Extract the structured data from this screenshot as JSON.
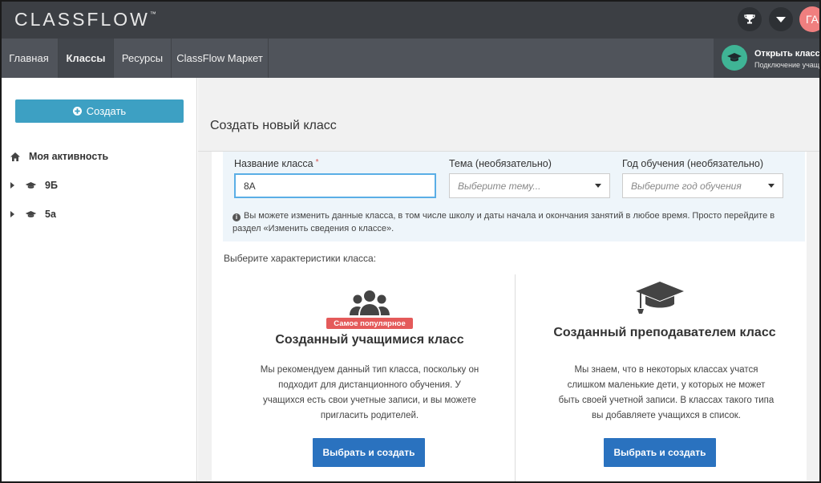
{
  "app": {
    "logo": "CLASSFLOW",
    "logo_tm": "™",
    "avatar_initials": "ГА"
  },
  "nav": {
    "tabs": [
      {
        "label": "Главная",
        "active": false
      },
      {
        "label": "Классы",
        "active": true
      },
      {
        "label": "Ресурсы",
        "active": false
      },
      {
        "label": "ClassFlow Маркет",
        "active": false
      }
    ],
    "open_class": {
      "title": "Открыть класс",
      "subtitle": "Подключение учащ..."
    }
  },
  "sidebar": {
    "create_label": "Создать",
    "items": [
      {
        "label": "Моя активность",
        "icon": "home-icon"
      },
      {
        "label": "9Б",
        "icon": "graduation-cap-icon"
      },
      {
        "label": "5а",
        "icon": "graduation-cap-icon"
      }
    ]
  },
  "main": {
    "title": "Создать новый класс",
    "form": {
      "class_name_label": "Название класса",
      "required_mark": "*",
      "class_name_value": "8А",
      "subject_label": "Тема (необязательно)",
      "subject_placeholder": "Выберите тему...",
      "year_label": "Год обучения (необязательно)",
      "year_placeholder": "Выберите год обучения",
      "info_text": "Вы можете изменить данные класса, в том числе школу и даты начала и окончания занятий в любое время. Просто перейдите в раздел «Изменить сведения о классе»."
    },
    "choose_label": "Выберите характеристики класса:",
    "cards": [
      {
        "badge": "Самое популярное",
        "title": "Созданный учащимися класс",
        "desc": "Мы рекомендуем данный тип класса, поскольку он подходит для дистанционного обучения. У учащихся есть свои учетные записи, и вы можете пригласить родителей.",
        "button": "Выбрать и создать"
      },
      {
        "title": "Созданный преподавателем класс",
        "desc": "Мы знаем, что в некоторых классах учатся слишком маленькие дети, у которых не может быть своей учетной записи. В классах такого типа вы добавляете учащихся в список.",
        "button": "Выбрать и создать"
      }
    ]
  },
  "colors": {
    "topbar": "#3c3f44",
    "navbar": "#50545b",
    "create_button": "#3da0c3",
    "primary_button": "#2a72bf",
    "badge": "#e45a5a",
    "avatar": "#f07f7f",
    "open_class_circle": "#3fb495"
  }
}
